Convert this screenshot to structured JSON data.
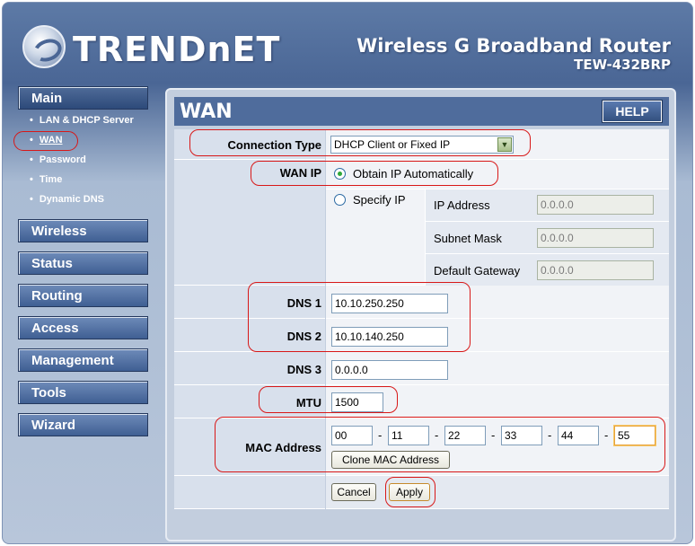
{
  "header": {
    "logo_text": "TRENDnET",
    "product_name": "Wireless G Broadband Router",
    "model": "TEW-432BRP"
  },
  "sidebar": {
    "main_label": "Main",
    "sub_items": [
      {
        "label": "LAN & DHCP Server"
      },
      {
        "label": "WAN"
      },
      {
        "label": "Password"
      },
      {
        "label": "Time"
      },
      {
        "label": "Dynamic DNS"
      }
    ],
    "sections": [
      {
        "label": "Wireless"
      },
      {
        "label": "Status"
      },
      {
        "label": "Routing"
      },
      {
        "label": "Access"
      },
      {
        "label": "Management"
      },
      {
        "label": "Tools"
      },
      {
        "label": "Wizard"
      }
    ],
    "bullet": "•"
  },
  "panel": {
    "title": "WAN",
    "help_label": "HELP"
  },
  "form": {
    "connection_type_label": "Connection Type",
    "connection_type_value": "DHCP Client or Fixed IP",
    "wan_ip_label": "WAN IP",
    "obtain_label": "Obtain IP Automatically",
    "specify_label": "Specify IP",
    "ip_address_label": "IP Address",
    "ip_address_value": "0.0.0.0",
    "subnet_mask_label": "Subnet Mask",
    "subnet_mask_value": "0.0.0.0",
    "gateway_label": "Default Gateway",
    "gateway_value": "0.0.0.0",
    "dns1_label": "DNS 1",
    "dns1_value": "10.10.250.250",
    "dns2_label": "DNS 2",
    "dns2_value": "10.10.140.250",
    "dns3_label": "DNS 3",
    "dns3_value": "0.0.0.0",
    "mtu_label": "MTU",
    "mtu_value": "1500",
    "mac_label": "MAC Address",
    "mac_octets": [
      "00",
      "11",
      "22",
      "33",
      "44",
      "55"
    ],
    "mac_separator": "-",
    "clone_mac_label": "Clone MAC Address",
    "cancel_label": "Cancel",
    "apply_label": "Apply"
  },
  "colors": {
    "header_blue": "#4a6695",
    "highlight_red": "#d81818",
    "label_cell": "#d8e0ec",
    "value_cell": "#f1f3f7"
  },
  "icons": {
    "dropdown": "chevron-down-icon",
    "logo": "trendnet-logo-icon"
  }
}
